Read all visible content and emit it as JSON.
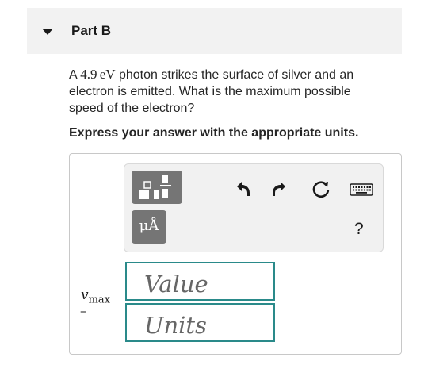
{
  "part": {
    "title": "Part B"
  },
  "question": {
    "prefix": "A ",
    "energy_value": "4.9",
    "energy_unit": "eV",
    "suffix": " photon strikes the surface of silver and an electron is emitted. What is the maximum possible speed of the electron?"
  },
  "instruction": "Express your answer with the appropriate units.",
  "toolbar": {
    "units_symbol": "μÅ",
    "help_label": "?",
    "icons": [
      "templates-icon",
      "units-icon",
      "undo-icon",
      "redo-icon",
      "reset-icon",
      "keyboard-icon"
    ]
  },
  "answer": {
    "variable": "v",
    "subscript": "max",
    "equals": "=",
    "value_placeholder": "Value",
    "units_placeholder": "Units"
  },
  "colors": {
    "input_border": "#2a8a8a",
    "tool_button": "#757575",
    "header_bg": "#f2f2f2"
  }
}
